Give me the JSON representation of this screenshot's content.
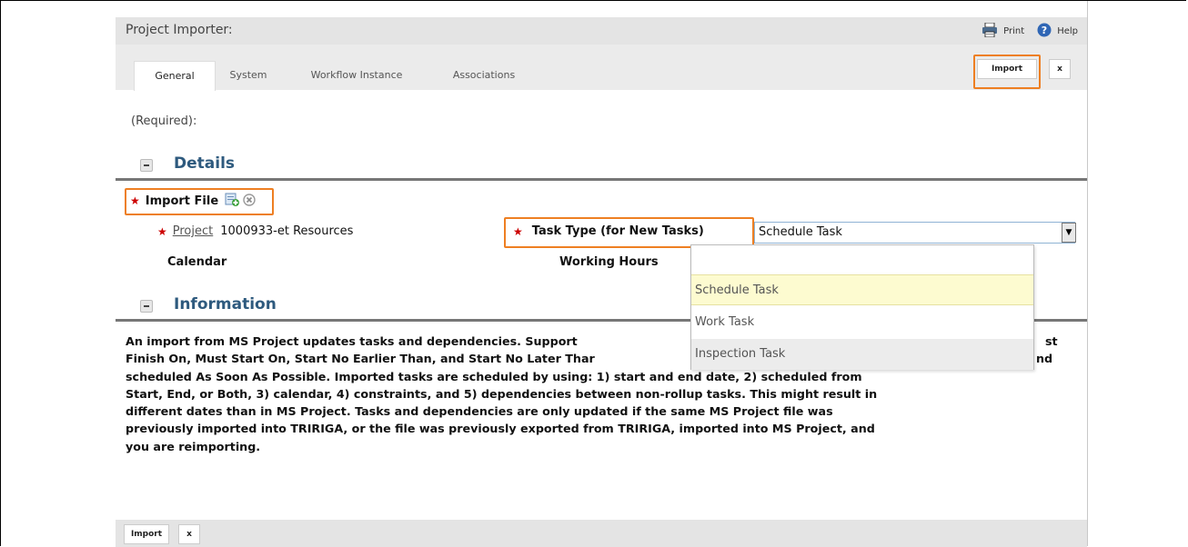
{
  "window": {
    "title": "Project Importer:"
  },
  "toolbar": {
    "print_label": "Print",
    "help_label": "Help"
  },
  "tabs": [
    {
      "label": "General",
      "active": true
    },
    {
      "label": "System",
      "active": false
    },
    {
      "label": "Workflow Instance",
      "active": false
    },
    {
      "label": "Associations",
      "active": false
    }
  ],
  "actions": {
    "import_label": "Import",
    "close_label": "x"
  },
  "form": {
    "required_note": "(Required):",
    "details_title": "Details",
    "import_file_label": "Import File",
    "project_label": "Project",
    "project_value": "1000933-et Resources",
    "task_type_label": "Task Type (for New Tasks)",
    "task_type_value": "Schedule Task",
    "calendar_label": "Calendar",
    "working_hours_label": "Working Hours",
    "information_title": "Information"
  },
  "dropdown": {
    "search_value": "",
    "options": [
      "Schedule Task",
      "Work Task",
      "Inspection Task"
    ],
    "highlighted": "Schedule Task"
  },
  "info": {
    "lines": [
      "An import from MS Project updates tasks and dependencies. Support",
      "st",
      "Finish On, Must Start On, Start No Earlier Than, and Start No Later Thar",
      "nd",
      "scheduled As Soon As Possible. Imported tasks are scheduled by using: 1) start and end date, 2) scheduled from",
      "Start, End, or Both, 3) calendar, 4) constraints, and 5) dependencies between non-rollup tasks. This might result in",
      "different dates than in MS Project. Tasks and dependencies are only updated if the same MS Project file was",
      "previously imported into TRIRIGA, or the file was previously exported from TRIRIGA, imported into MS Project, and",
      "you are reimporting."
    ]
  },
  "footer": {
    "import_label": "Import",
    "close_label": "x"
  },
  "colors": {
    "accent": "#ee7f22",
    "section_title": "#2e5a7e",
    "required_star": "#cc0000",
    "dropdown_highlight": "#fdfbd0"
  }
}
